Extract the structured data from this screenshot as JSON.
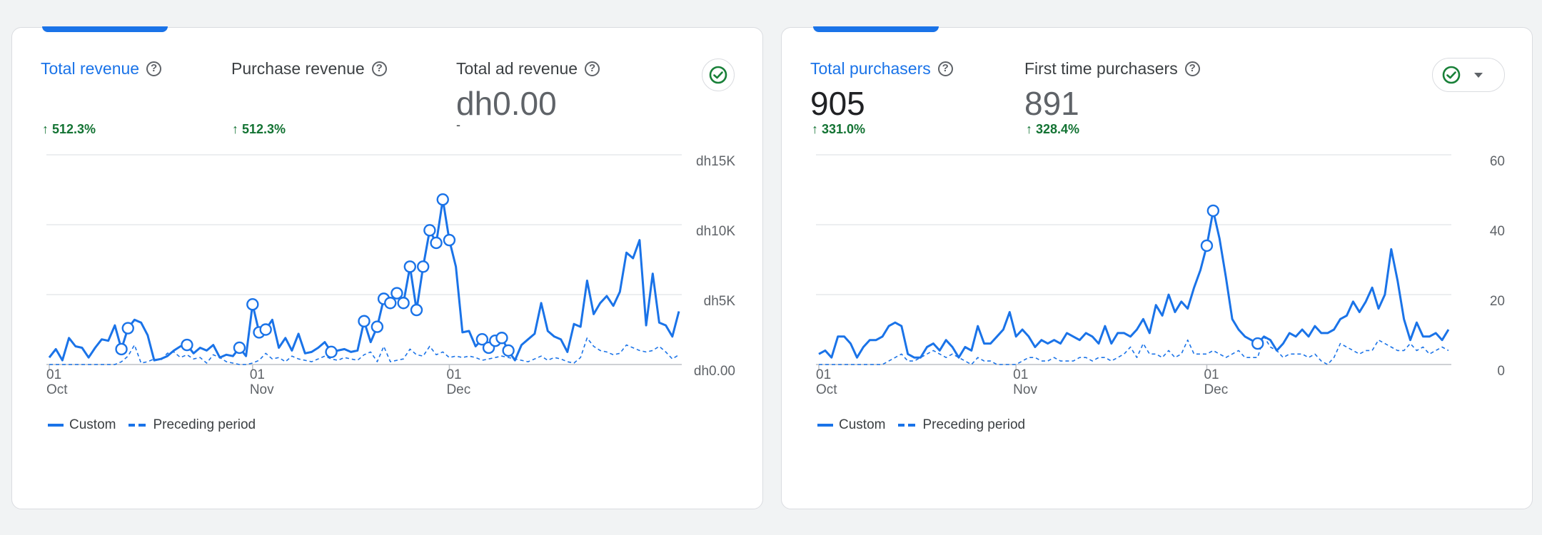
{
  "revenue_card": {
    "metrics": [
      {
        "label": "Total revenue",
        "value": "",
        "change": "512.3%",
        "active": true
      },
      {
        "label": "Purchase revenue",
        "value": "",
        "change": "512.3%",
        "active": false
      },
      {
        "label": "Total ad revenue",
        "value": "dh0.00",
        "change": "-",
        "active": false
      }
    ],
    "legend": {
      "series1": "Custom",
      "series2": "Preceding period"
    }
  },
  "purchasers_card": {
    "metrics": [
      {
        "label": "Total purchasers",
        "value": "905",
        "change": "331.0%",
        "active": true
      },
      {
        "label": "First time purchasers",
        "value": "891",
        "change": "328.4%",
        "active": false
      }
    ],
    "legend": {
      "series1": "Custom",
      "series2": "Preceding period"
    }
  },
  "icons": {
    "help": "help-circle-icon",
    "check": "check-circle-icon",
    "dropdown": "chevron-down-icon"
  },
  "colors": {
    "accent": "#1a73e8",
    "positive": "#137333",
    "check": "#188038"
  },
  "chart_data": [
    {
      "type": "line",
      "x_tick_labels": [
        [
          "01",
          "Oct"
        ],
        [
          "01",
          "Nov"
        ],
        [
          "01",
          "Dec"
        ]
      ],
      "y_tick_labels": [
        "dh0.00",
        "dh5K",
        "dh10K",
        "dh15K"
      ],
      "ylim": [
        0,
        15000
      ],
      "x_start": "2023-10-01",
      "series": [
        {
          "name": "Custom",
          "style": "solid",
          "values": [
            500,
            1100,
            300,
            1900,
            1300,
            1200,
            500,
            1200,
            1800,
            1700,
            2800,
            1100,
            2600,
            3200,
            3000,
            2100,
            300,
            400,
            600,
            1000,
            1300,
            1400,
            800,
            1200,
            1000,
            1400,
            500,
            700,
            600,
            1200,
            600,
            4300,
            2300,
            2500,
            3200,
            1200,
            1900,
            1000,
            2200,
            800,
            900,
            1200,
            1600,
            900,
            1000,
            1100,
            900,
            1000,
            3100,
            1600,
            2700,
            4700,
            4400,
            5100,
            4400,
            7000,
            3900,
            7000,
            9600,
            8700,
            11800,
            8900,
            7000,
            2300,
            2400,
            1300,
            1800,
            1200,
            1700,
            1900,
            1000,
            300,
            1400,
            1800,
            2200,
            4400,
            2400,
            2000,
            1800,
            900,
            2900,
            2700,
            6000,
            3600,
            4400,
            4900,
            4200,
            5200,
            8000,
            7600,
            8900,
            2800,
            6500,
            3000,
            2800,
            2000,
            3800
          ]
        },
        {
          "name": "Preceding period",
          "style": "dashed",
          "values": [
            0,
            0,
            0,
            0,
            0,
            0,
            0,
            0,
            0,
            0,
            0,
            200,
            600,
            1400,
            100,
            200,
            400,
            300,
            800,
            900,
            500,
            700,
            400,
            500,
            100,
            700,
            500,
            200,
            100,
            0,
            0,
            100,
            300,
            800,
            400,
            500,
            200,
            600,
            400,
            300,
            200,
            400,
            600,
            400,
            300,
            500,
            400,
            300,
            700,
            900,
            200,
            1300,
            200,
            300,
            400,
            1100,
            700,
            600,
            1300,
            700,
            900,
            500,
            600,
            500,
            600,
            500,
            300,
            400,
            500,
            600,
            500,
            400,
            300,
            200,
            400,
            600,
            300,
            500,
            400,
            200,
            100,
            500,
            1900,
            1300,
            1000,
            900,
            700,
            800,
            1400,
            1200,
            1000,
            900,
            1000,
            1300,
            900,
            400,
            700
          ]
        }
      ]
    },
    {
      "type": "line",
      "x_tick_labels": [
        [
          "01",
          "Oct"
        ],
        [
          "01",
          "Nov"
        ],
        [
          "01",
          "Dec"
        ]
      ],
      "y_tick_labels": [
        "0",
        "20",
        "40",
        "60"
      ],
      "ylim": [
        0,
        60
      ],
      "x_start": "2023-10-01",
      "series": [
        {
          "name": "Custom",
          "style": "solid",
          "values": [
            3,
            4,
            2,
            8,
            8,
            6,
            2,
            5,
            7,
            7,
            8,
            11,
            12,
            11,
            3,
            2,
            2,
            5,
            6,
            4,
            7,
            5,
            2,
            5,
            4,
            11,
            6,
            6,
            8,
            10,
            15,
            8,
            10,
            8,
            5,
            7,
            6,
            7,
            6,
            9,
            8,
            7,
            9,
            8,
            6,
            11,
            6,
            9,
            9,
            8,
            10,
            13,
            9,
            17,
            14,
            20,
            15,
            18,
            16,
            22,
            27,
            34,
            44,
            36,
            25,
            13,
            10,
            8,
            7,
            6,
            8,
            7,
            4,
            6,
            9,
            8,
            10,
            8,
            11,
            9,
            9,
            10,
            13,
            14,
            18,
            15,
            18,
            22,
            16,
            20,
            33,
            24,
            13,
            7,
            12,
            8,
            8,
            9,
            7,
            10
          ]
        },
        {
          "name": "Preceding period",
          "style": "dashed",
          "values": [
            0,
            0,
            0,
            0,
            0,
            0,
            0,
            0,
            0,
            0,
            0,
            1,
            2,
            3,
            1,
            1,
            2,
            3,
            4,
            3,
            2,
            3,
            2,
            1,
            0,
            2,
            1,
            1,
            0,
            0,
            0,
            0,
            1,
            2,
            2,
            1,
            1,
            2,
            1,
            1,
            1,
            2,
            2,
            1,
            2,
            2,
            1,
            2,
            3,
            5,
            2,
            6,
            3,
            3,
            2,
            4,
            2,
            3,
            7,
            3,
            3,
            3,
            4,
            3,
            2,
            3,
            4,
            2,
            2,
            2,
            8,
            5,
            4,
            2,
            3,
            3,
            3,
            2,
            3,
            1,
            0,
            2,
            6,
            5,
            4,
            3,
            4,
            4,
            7,
            6,
            5,
            4,
            4,
            6,
            4,
            5,
            3,
            4,
            5,
            4
          ]
        }
      ]
    }
  ]
}
